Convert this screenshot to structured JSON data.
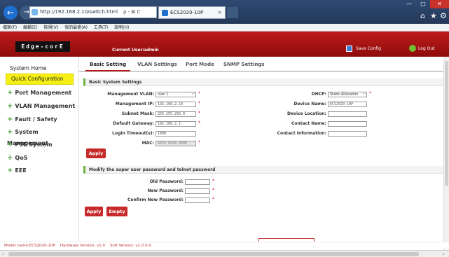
{
  "browser": {
    "url": "http://192.168.2.10/switch.html",
    "addr_controls": "ρ - ⊠ C",
    "tab_title": "ECS2020-10P",
    "menu": [
      "檔案(F)",
      "編輯(E)",
      "檢視(V)",
      "我的最愛(A)",
      "工具(T)",
      "說明(H)"
    ]
  },
  "header": {
    "logo": "Edge-corE",
    "current_user": "Current User:admin",
    "save_config": "Save Config",
    "logout": "Log Out"
  },
  "sidebar": {
    "home": "System Home",
    "quick": "Quick Configuration",
    "items": [
      "Port Management",
      "VLAN Management",
      "Fault / Safety",
      "System Management",
      "PSE System",
      "QoS",
      "EEE"
    ]
  },
  "tabs": [
    "Basic Setting",
    "VLAN Settings",
    "Port Mode",
    "SNMP Settings"
  ],
  "basic": {
    "title": "Basic System Settings",
    "mgmt_vlan_label": "Management VLAN:",
    "mgmt_vlan_value": "vlan 1",
    "mgmt_ip_label": "Management IP:",
    "mgmt_ip_value": "192.168.2.10",
    "subnet_label": "Subnet Mask:",
    "subnet_value": "255.255.255.0",
    "gateway_label": "Default Gateway:",
    "gateway_value": "192.168.2.1",
    "login_timeout_label": "Login Timeout(s):",
    "login_timeout_value": "1800",
    "mac_label": "MAC:",
    "mac_value": "A828.8048.8008",
    "dhcp_label": "DHCP:",
    "dhcp_value": "Static Allocation",
    "device_name_label": "Device Name:",
    "device_name_value": "ECS2020-10P",
    "device_location_label": "Device Location:",
    "contact_name_label": "Contact Name:",
    "contact_info_label": "Contact Information:",
    "apply": "Apply"
  },
  "password": {
    "title": "Modify the super user password and telnet password",
    "old_label": "Old Password:",
    "new_label": "New Password:",
    "confirm_label": "Confirm New Password:",
    "apply": "Apply",
    "empty": "Empty"
  },
  "footer": {
    "model": "Model name:ECS2020-10P",
    "hardware": "Hardware Version: v1.0",
    "software": "Soft Version: v1.0.0.0"
  },
  "star": "*"
}
